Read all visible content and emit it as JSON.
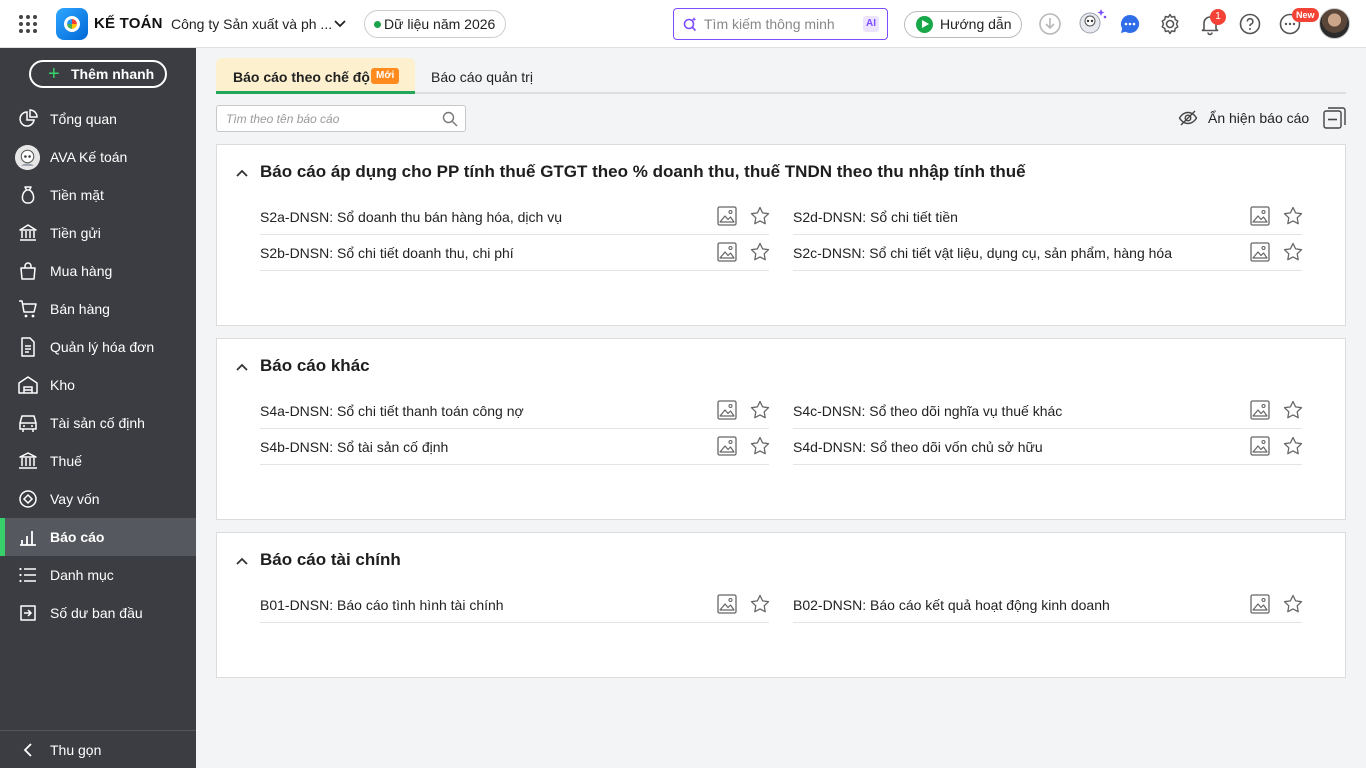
{
  "topbar": {
    "brand": "KẾ TOÁN",
    "company": "Công ty Sản xuất và ph ...",
    "year": "Dữ liệu năm 2026",
    "search_placeholder": "Tìm kiếm thông minh",
    "ai_label": "AI",
    "guide": "Hướng dẫn",
    "notif_count": "1",
    "new_badge": "New"
  },
  "sidebar": {
    "quick_add": "Thêm nhanh",
    "items": [
      {
        "label": "Tổng quan",
        "icon": "dashboard-icon"
      },
      {
        "label": "AVA Kế toán",
        "icon": "ava-avatar-icon"
      },
      {
        "label": "Tiền mặt",
        "icon": "cash-icon"
      },
      {
        "label": "Tiền gửi",
        "icon": "bank-icon"
      },
      {
        "label": "Mua hàng",
        "icon": "shopping-bag-icon"
      },
      {
        "label": "Bán hàng",
        "icon": "cart-icon"
      },
      {
        "label": "Quản lý hóa đơn",
        "icon": "invoice-icon"
      },
      {
        "label": "Kho",
        "icon": "warehouse-icon"
      },
      {
        "label": "Tài sản cố định",
        "icon": "asset-icon"
      },
      {
        "label": "Thuế",
        "icon": "tax-icon"
      },
      {
        "label": "Vay vốn",
        "icon": "loan-icon"
      },
      {
        "label": "Báo cáo",
        "icon": "report-chart-icon",
        "active": true
      },
      {
        "label": "Danh mục",
        "icon": "list-icon"
      },
      {
        "label": "Số dư ban đầu",
        "icon": "opening-balance-icon"
      }
    ],
    "collapse": "Thu gọn"
  },
  "tabs": {
    "active": "Báo cáo theo chế độ",
    "active_badge": "Mới",
    "second": "Báo cáo quản trị"
  },
  "search": {
    "placeholder": "Tìm theo tên báo cáo"
  },
  "toggle_reports": "Ẩn hiện báo cáo",
  "sections": [
    {
      "title": "Báo cáo áp dụng cho PP tính thuế GTGT theo % doanh thu, thuế TNDN theo thu nhập tính thuế",
      "reports": [
        "S2a-DNSN: Sổ doanh thu bán hàng hóa, dịch vụ",
        "S2d-DNSN: Sổ chi tiết tiền",
        "S2b-DNSN: Sổ chi tiết doanh thu, chi phí",
        "S2c-DNSN: Sổ chi tiết vật liệu, dụng cụ, sản phẩm, hàng hóa"
      ]
    },
    {
      "title": "Báo cáo khác",
      "reports": [
        "S4a-DNSN: Sổ chi tiết thanh toán công nợ",
        "S4c-DNSN: Sổ theo dõi nghĩa vụ thuế khác",
        "S4b-DNSN: Sổ tài sản cố định",
        "S4d-DNSN: Sổ theo dõi vốn chủ sở hữu"
      ]
    },
    {
      "title": "Báo cáo tài chính",
      "reports": [
        "B01-DNSN: Báo cáo tình hình tài chính",
        "B02-DNSN: Báo cáo kết quả hoạt động kinh doanh"
      ]
    }
  ],
  "colors": {
    "accent": "#20a75b",
    "sidebar": "#3b3d42",
    "ai": "#7c4dff",
    "badge": "#f44336"
  }
}
